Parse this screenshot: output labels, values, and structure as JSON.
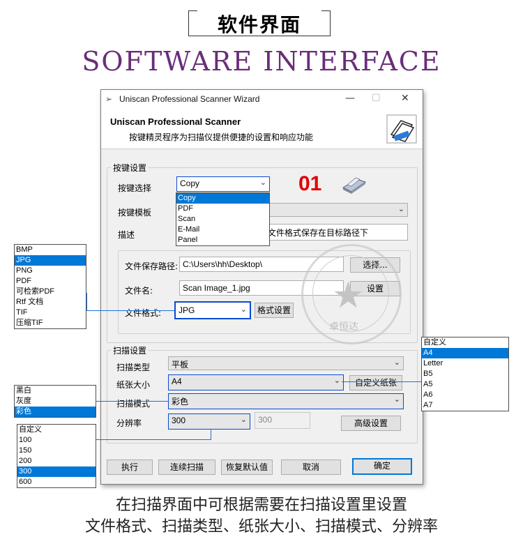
{
  "banner": {
    "cn_title": "软件界面",
    "en_title": "SOFTWARE INTERFACE"
  },
  "window": {
    "title": "Uniscan Professional Scanner Wizard",
    "controls": {
      "minimize": "—",
      "maximize": "☐",
      "close": "✕"
    },
    "header_title": "Uniscan Professional Scanner",
    "header_subtitle": "按键精灵程序为扫描仪提供便捷的设置和响应功能"
  },
  "key_settings": {
    "group_label": "按键设置",
    "key_select_label": "按键选择",
    "key_select_value": "Copy",
    "key_options": [
      "Copy",
      "PDF",
      "Scan",
      "E-Mail",
      "Panel"
    ],
    "key_options_selected": 0,
    "number_badge": "01",
    "key_template_label": "按键模板",
    "description_label": "描述",
    "description_value": "文件格式保存在目标路径下",
    "save_path_label": "文件保存路径:",
    "save_path_value": "C:\\Users\\hh\\Desktop\\",
    "browse_button": "选择...",
    "filename_label": "文件名:",
    "filename_value": "Scan Image_1.jpg",
    "settings_button": "设置",
    "format_label": "文件格式:",
    "format_value": "JPG",
    "format_settings_button": "格式设置"
  },
  "format_popup": {
    "options": [
      "BMP",
      "JPG",
      "PNG",
      "PDF",
      "可检索PDF",
      "Rtf 文档",
      "TIF",
      "压缩TIF"
    ],
    "selected": 1
  },
  "scan_settings": {
    "group_label": "扫描设置",
    "scan_type_label": "扫描类型",
    "scan_type_value": "平板",
    "paper_size_label": "纸张大小",
    "paper_size_value": "A4",
    "custom_paper_button": "自定义纸张",
    "scan_mode_label": "扫描模式",
    "scan_mode_value": "彩色",
    "resolution_label": "分辨率",
    "resolution_value": "300",
    "resolution_custom_value": "300",
    "advanced_button": "高级设置"
  },
  "paper_popup": {
    "options": [
      "自定义",
      "A4",
      "Letter",
      "B5",
      "A5",
      "A6",
      "A7"
    ],
    "selected": 1
  },
  "mode_popup": {
    "options": [
      "黑白",
      "灰度",
      "彩色"
    ],
    "selected": 2
  },
  "resolution_popup": {
    "options": [
      "自定义",
      "100",
      "150",
      "200",
      "300",
      "600"
    ],
    "selected": 4
  },
  "footer_buttons": {
    "run": "执行",
    "continuous": "连续扫描",
    "restore": "恢复默认值",
    "cancel": "取消",
    "ok": "确定"
  },
  "stamp": {
    "text": "卓恒达",
    "ring_text": "北京卓恒达科技有限公司"
  },
  "captions": {
    "line1": "在扫描界面中可根据需要在扫描设置里设置",
    "line2": "文件格式、扫描类型、纸张大小、扫描模式、分辨率"
  },
  "colors": {
    "accent": "#0078d7",
    "badge": "#e00000",
    "en_title": "#6a2d7a"
  }
}
